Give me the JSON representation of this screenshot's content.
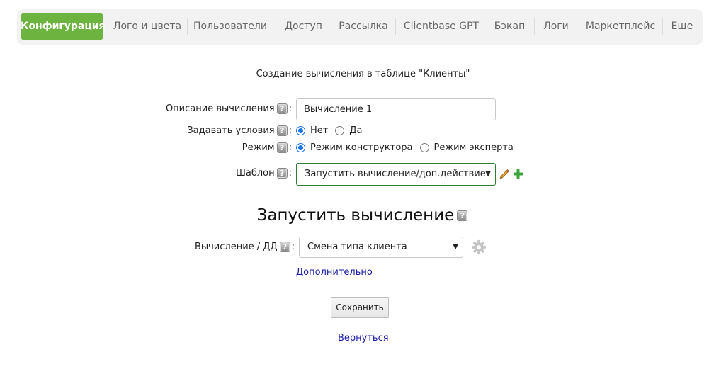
{
  "nav": {
    "tabs": [
      {
        "label": "Конфигурация",
        "active": true
      },
      {
        "label": "Лого и цвета"
      },
      {
        "label": "Пользователи"
      },
      {
        "label": "Доступ"
      },
      {
        "label": "Рассылка"
      },
      {
        "label": "Clientbase GPT"
      },
      {
        "label": "Бэкап"
      },
      {
        "label": "Логи"
      },
      {
        "label": "Маркетплейс"
      },
      {
        "label": "Еще"
      }
    ],
    "accent_color": "#6db33f"
  },
  "form": {
    "heading": "Создание вычисления в таблице \"Клиенты\"",
    "description": {
      "label": "Описание вычисления",
      "value": "Вычисление 1"
    },
    "conditions": {
      "label": "Задавать условия",
      "options": [
        "Нет",
        "Да"
      ],
      "selected": "Нет"
    },
    "mode": {
      "label": "Режим",
      "options": [
        "Режим конструктора",
        "Режим эксперта"
      ],
      "selected": "Режим конструктора"
    },
    "template": {
      "label": "Шаблон",
      "value": "Запустить вычисление/доп.действие"
    },
    "help_glyph": "?",
    "colon": ":"
  },
  "section": {
    "title": "Запустить вычисление",
    "calc": {
      "label": "Вычисление / ДД",
      "value": "Смена типа клиента"
    },
    "more_link": "Дополнительно",
    "save_button": "Сохранить",
    "back_link": "Вернуться"
  },
  "icons": {
    "help": "help-icon",
    "edit": "pencil-icon",
    "add": "plus-icon",
    "settings": "gear-icon",
    "dropdown": "dropdown-arrow-icon"
  }
}
